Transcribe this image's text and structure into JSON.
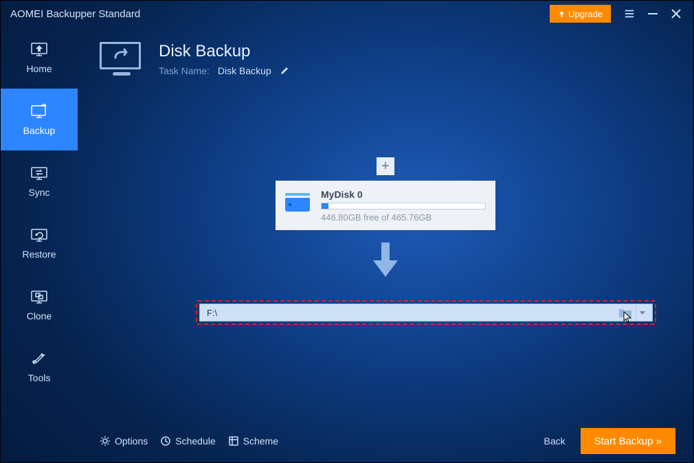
{
  "app_title": "AOMEI Backupper Standard",
  "titlebar": {
    "upgrade_label": "Upgrade"
  },
  "sidebar": {
    "items": [
      {
        "label": "Home"
      },
      {
        "label": "Backup"
      },
      {
        "label": "Sync"
      },
      {
        "label": "Restore"
      },
      {
        "label": "Clone"
      },
      {
        "label": "Tools"
      }
    ],
    "active_index": 1
  },
  "header": {
    "title": "Disk Backup",
    "task_name_label": "Task Name:",
    "task_name_value": "Disk Backup"
  },
  "source_disk": {
    "name": "MyDisk 0",
    "free_text": "446.80GB free of 465.76GB",
    "used_percent": 4
  },
  "destination": {
    "path": "F:\\"
  },
  "footer": {
    "options_label": "Options",
    "schedule_label": "Schedule",
    "scheme_label": "Scheme",
    "back_label": "Back",
    "start_label": "Start Backup  »"
  }
}
